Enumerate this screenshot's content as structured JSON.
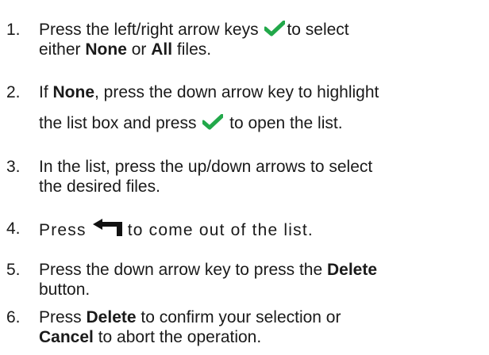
{
  "steps": [
    {
      "number": "1.",
      "line1": "Press the left/right arrow keys ",
      "line1_after": "to select",
      "line2_pre": "either ",
      "line2_bold1": "None",
      "line2_mid": " or ",
      "line2_bold2": "All",
      "line2_post": " files."
    },
    {
      "number": "2.",
      "line1_pre": "If ",
      "line1_bold": "None",
      "line1_post": ", press the down arrow key to highlight",
      "line2_pre": "the list box and press ",
      "line2_post": " to open the list."
    },
    {
      "number": "3.",
      "line1": "In the list, press the up/down arrows to select",
      "line2": "the desired files."
    },
    {
      "number": "4.",
      "pre": "Press",
      "post": "to come out of the list."
    },
    {
      "number": "5.",
      "line1_pre": "Press the down arrow key to press the ",
      "line1_bold": "Delete",
      "line2": "button."
    },
    {
      "number": "6.",
      "line1_pre": "Press ",
      "line1_bold": "Delete",
      "line1_post": " to confirm your selection or",
      "line2_bold": "Cancel",
      "line2_post": " to abort the operation."
    }
  ],
  "icons": {
    "check": "checkmark-icon",
    "back": "back-arrow-icon",
    "check_color": "#22a84a"
  }
}
